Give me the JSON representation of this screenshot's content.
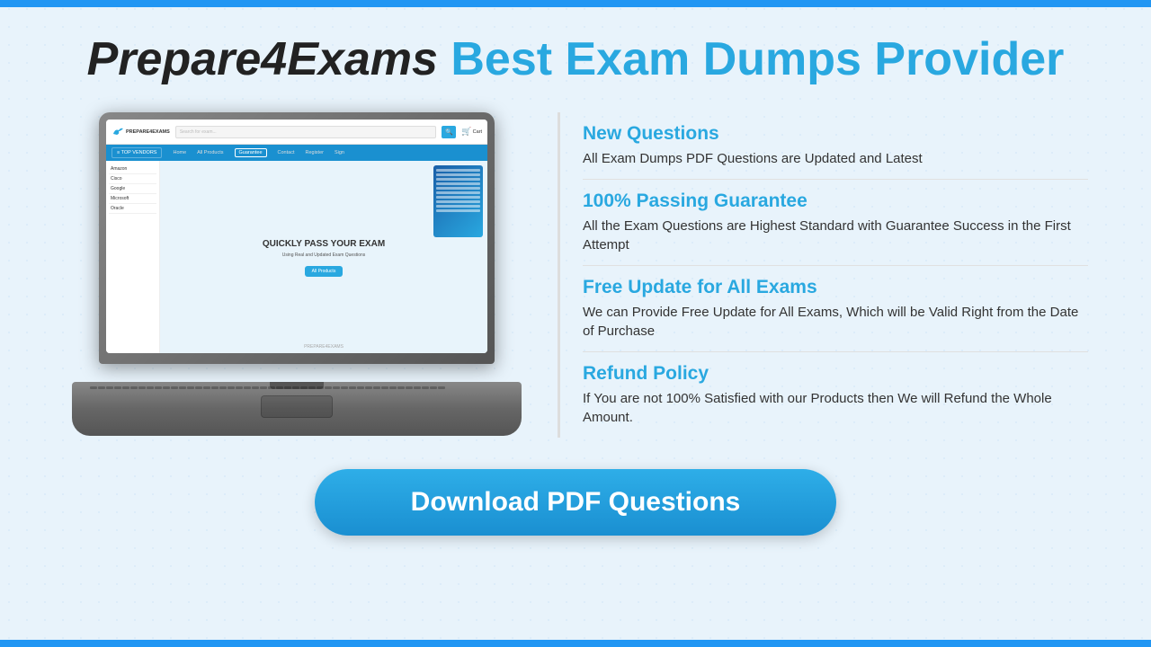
{
  "header": {
    "brand": "Prepare4Exams",
    "tagline": "Best Exam Dumps Provider"
  },
  "features": [
    {
      "title": "New Questions",
      "description": "All Exam Dumps PDF Questions are Updated and Latest"
    },
    {
      "title": "100% Passing Guarantee",
      "description": "All the Exam Questions are Highest Standard with Guarantee Success in the First Attempt"
    },
    {
      "title": "Free Update for All Exams",
      "description": "We can Provide Free Update for All Exams, Which will be Valid Right from the Date of Purchase"
    },
    {
      "title": "Refund Policy",
      "description": "If You are not 100% Satisfied with our Products then We will Refund the Whole Amount."
    }
  ],
  "site_mockup": {
    "logo": "PREPARE4EXAMS",
    "search_placeholder": "Search for exam...",
    "nav_items": [
      "Home",
      "All Products",
      "Guarantee",
      "Contact",
      "Register",
      "Sign"
    ],
    "nav_menu": "≡  TOP VENDORS",
    "hero_title": "QUICKLY PASS YOUR EXAM",
    "hero_subtitle": "Using Real and Updated Exam Questions",
    "hero_button": "All Products",
    "sidebar_items": [
      "Amazon",
      "Cisco",
      "Google",
      "Microsoft",
      "Oracle"
    ],
    "footer_logo": "PREPARE4EXAMS",
    "cart": "Cart"
  },
  "download_button": {
    "label": "Download PDF Questions"
  }
}
